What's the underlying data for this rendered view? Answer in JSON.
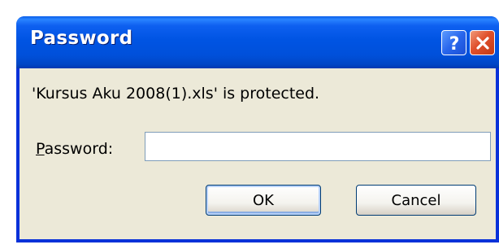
{
  "dialog": {
    "title": "Password",
    "message": "'Kursus Aku 2008(1).xls' is protected.",
    "password_label_mnemonic": "P",
    "password_label_rest": "assword:",
    "password_value": "",
    "ok_label": "OK",
    "cancel_label": "Cancel",
    "help_icon": "question-mark",
    "close_icon": "x-cross"
  },
  "colors": {
    "titlebar": "#0054e3",
    "frame": "#0831d9",
    "client_background": "#ece9d8",
    "close_button": "#e0502c",
    "help_button": "#2966ec"
  }
}
